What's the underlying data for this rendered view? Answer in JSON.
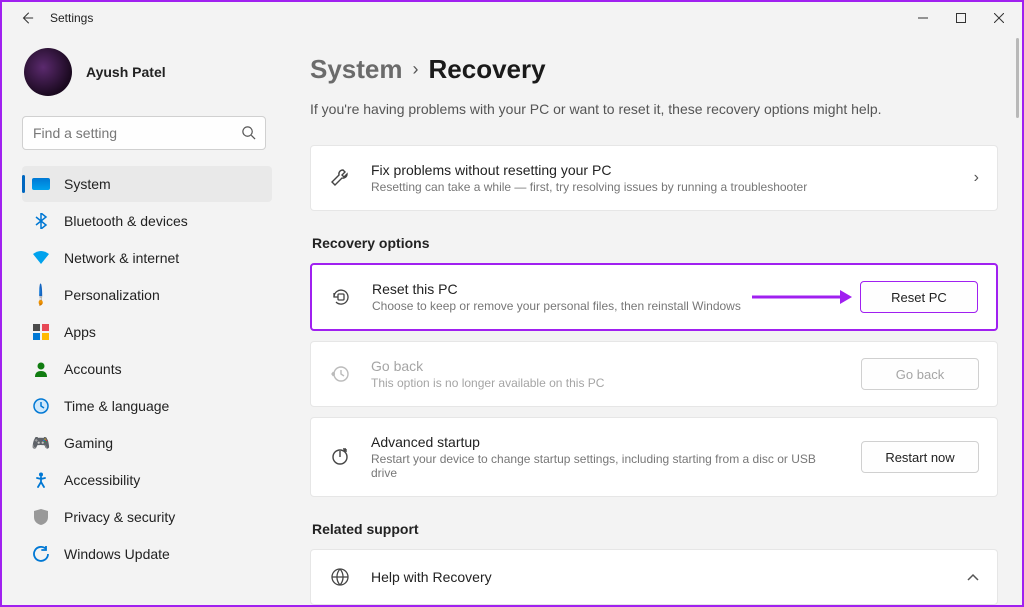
{
  "window": {
    "title": "Settings"
  },
  "profile": {
    "name": "Ayush Patel"
  },
  "search": {
    "placeholder": "Find a setting"
  },
  "sidebar": {
    "items": [
      {
        "label": "System"
      },
      {
        "label": "Bluetooth & devices"
      },
      {
        "label": "Network & internet"
      },
      {
        "label": "Personalization"
      },
      {
        "label": "Apps"
      },
      {
        "label": "Accounts"
      },
      {
        "label": "Time & language"
      },
      {
        "label": "Gaming"
      },
      {
        "label": "Accessibility"
      },
      {
        "label": "Privacy & security"
      },
      {
        "label": "Windows Update"
      }
    ]
  },
  "breadcrumb": {
    "parent": "System",
    "current": "Recovery"
  },
  "intro": "If you're having problems with your PC or want to reset it, these recovery options might help.",
  "cards": {
    "fix": {
      "title": "Fix problems without resetting your PC",
      "sub": "Resetting can take a while — first, try resolving issues by running a troubleshooter"
    },
    "recovery_heading": "Recovery options",
    "reset": {
      "title": "Reset this PC",
      "sub": "Choose to keep or remove your personal files, then reinstall Windows",
      "button": "Reset PC"
    },
    "goback": {
      "title": "Go back",
      "sub": "This option is no longer available on this PC",
      "button": "Go back"
    },
    "advanced": {
      "title": "Advanced startup",
      "sub": "Restart your device to change startup settings, including starting from a disc or USB drive",
      "button": "Restart now"
    },
    "related_heading": "Related support",
    "help": {
      "title": "Help with Recovery"
    }
  }
}
